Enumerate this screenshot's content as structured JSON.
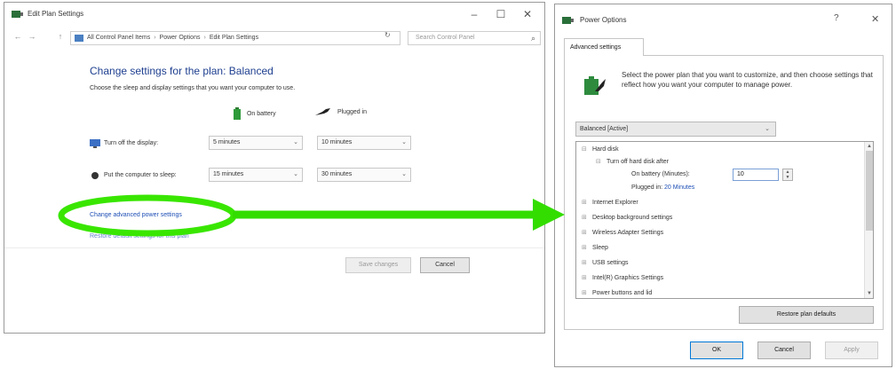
{
  "left_window": {
    "title": "Edit Plan Settings",
    "controls": {
      "minimize": "–",
      "maximize": "☐",
      "close": "✕"
    },
    "nav": {
      "back": "←",
      "forward": "→",
      "up": "↑"
    },
    "breadcrumb": [
      "All Control Panel Items",
      "Power Options",
      "Edit Plan Settings"
    ],
    "address_dropdown": "⌄",
    "address_refresh": "↻",
    "search_placeholder": "Search Control Panel",
    "search_glyph": "⌕",
    "heading": "Change settings for the plan: Balanced",
    "subheading": "Choose the sleep and display settings that you want your computer to use.",
    "col_battery": "On battery",
    "col_plugged": "Plugged in",
    "rows": [
      {
        "label": "Turn off the display:",
        "battery": "5 minutes",
        "plugged": "10 minutes"
      },
      {
        "label": "Put the computer to sleep:",
        "battery": "15 minutes",
        "plugged": "30 minutes"
      }
    ],
    "link_advanced": "Change advanced power settings",
    "link_restore": "Restore default settings for this plan",
    "save_label": "Save changes",
    "cancel_label": "Cancel"
  },
  "right_window": {
    "title": "Power Options",
    "help": "?",
    "close": "✕",
    "tab": "Advanced settings",
    "description": "Select the power plan that you want to customize, and then choose settings that reflect how you want your computer to manage power.",
    "plan_select": "Balanced [Active]",
    "tree": {
      "hard_disk": "Hard disk",
      "turn_off_hdd": "Turn off hard disk after",
      "on_battery_label": "On battery (Minutes):",
      "on_battery_value": "10",
      "plugged_label": "Plugged in:",
      "plugged_value": "20 Minutes",
      "items": [
        "Internet Explorer",
        "Desktop background settings",
        "Wireless Adapter Settings",
        "Sleep",
        "USB settings",
        "Intel(R) Graphics Settings",
        "Power buttons and lid"
      ],
      "expand_glyph": "⊞",
      "collapse_glyph": "⊟"
    },
    "restore_label": "Restore plan defaults",
    "ok_label": "OK",
    "cancel_label": "Cancel",
    "apply_label": "Apply"
  },
  "annotation": {
    "highlight_color": "#39e600",
    "arrow_color": "#33dd00"
  }
}
